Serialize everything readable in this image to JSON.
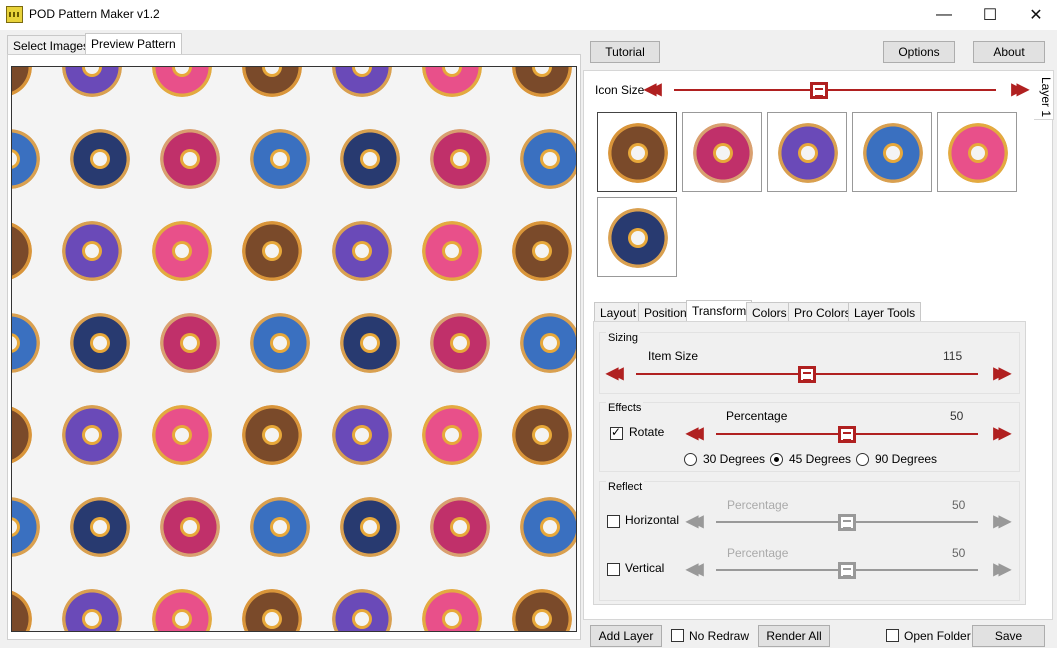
{
  "window": {
    "title": "POD Pattern Maker v1.2",
    "min_label": "—",
    "max_label": "☐",
    "close_label": "✕"
  },
  "left_tabs": [
    {
      "label": "Select Images"
    },
    {
      "label": "Preview Pattern"
    }
  ],
  "top_buttons": {
    "tutorial": "Tutorial",
    "options": "Options",
    "about": "About"
  },
  "layer_tab": "Layer 1",
  "icon_size": {
    "label": "Icon Size",
    "value_fraction": 0.45
  },
  "image_list": [
    {
      "name": "chocolate-donut"
    },
    {
      "name": "pink-sprinkle-donut"
    },
    {
      "name": "purple-donut"
    },
    {
      "name": "blue-donut"
    },
    {
      "name": "pink-donut"
    },
    {
      "name": "galaxy-donut"
    }
  ],
  "inner_tabs": [
    {
      "label": "Layout"
    },
    {
      "label": "Position"
    },
    {
      "label": "Transform"
    },
    {
      "label": "Colors"
    },
    {
      "label": "Pro Colors"
    },
    {
      "label": "Layer Tools"
    }
  ],
  "sizing": {
    "label": "Sizing",
    "item_size_label": "Item Size",
    "item_size_value": "115",
    "fraction": 0.5
  },
  "effects": {
    "label": "Effects",
    "rotate_label": "Rotate",
    "rotate_checked": true,
    "percentage_label": "Percentage",
    "percentage_value": "50",
    "fraction": 0.5,
    "radios": [
      {
        "label": "30 Degrees",
        "checked": false
      },
      {
        "label": "45 Degrees",
        "checked": true
      },
      {
        "label": "90 Degrees",
        "checked": false
      }
    ]
  },
  "reflect": {
    "label": "Reflect",
    "horizontal_label": "Horizontal",
    "vertical_label": "Vertical",
    "percentage_label": "Percentage",
    "h_value": "50",
    "v_value": "50"
  },
  "bottom": {
    "add_layer": "Add Layer",
    "no_redraw": "No Redraw",
    "render_all": "Render All",
    "open_folder": "Open Folder",
    "save": "Save"
  },
  "colors": {
    "accent": "#b02020",
    "disabled": "#999999"
  }
}
